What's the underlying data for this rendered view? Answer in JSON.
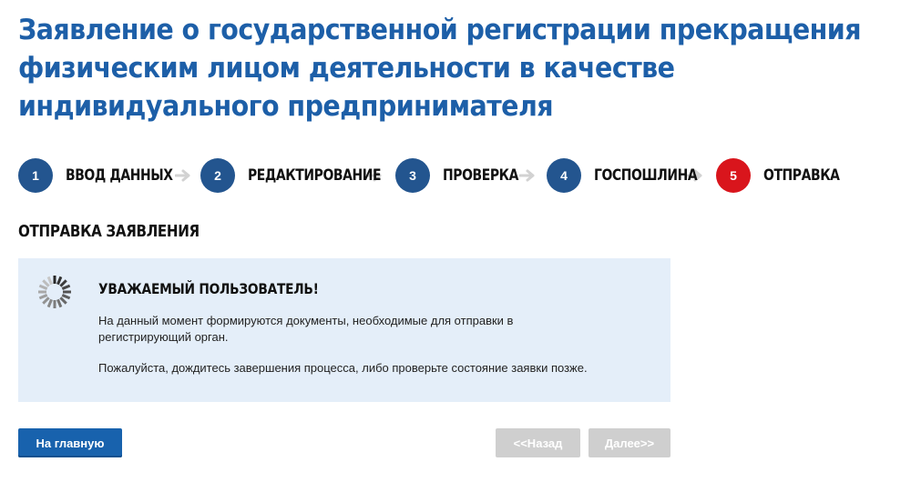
{
  "page": {
    "title": "Заявление о государственной регистрации прекращения физическим лицом деятельности в качестве индивидуального предпринимателя"
  },
  "steps": [
    {
      "number": "1",
      "label": "ВВОД ДАННЫХ",
      "active": false
    },
    {
      "number": "2",
      "label": "РЕДАКТИРОВАНИЕ",
      "active": false
    },
    {
      "number": "3",
      "label": "ПРОВЕРКА",
      "active": false
    },
    {
      "number": "4",
      "label": "ГОСПОШЛИНА",
      "active": false
    },
    {
      "number": "5",
      "label": "ОТПРАВКА",
      "active": true
    }
  ],
  "section": {
    "title": "ОТПРАВКА ЗАЯВЛЕНИЯ"
  },
  "notice": {
    "icon": "loading-spinner-icon",
    "heading": "УВАЖАЕМЫЙ ПОЛЬЗОВАТЕЛЬ!",
    "paragraph1": "На данный момент формируются документы, необходимые для отправки в регистрирующий орган.",
    "paragraph2": "Пожалуйста, дождитесь завершения процесса, либо проверьте состояние заявки позже."
  },
  "buttons": {
    "home": "На главную",
    "back": "<<Назад",
    "next": "Далее>>"
  },
  "colors": {
    "title": "#1d5fa8",
    "step_inactive": "#23558f",
    "step_active": "#d9151c",
    "notice_bg": "#e4eef9",
    "primary_button": "#1862ad",
    "disabled_button": "#cfcfcf"
  }
}
